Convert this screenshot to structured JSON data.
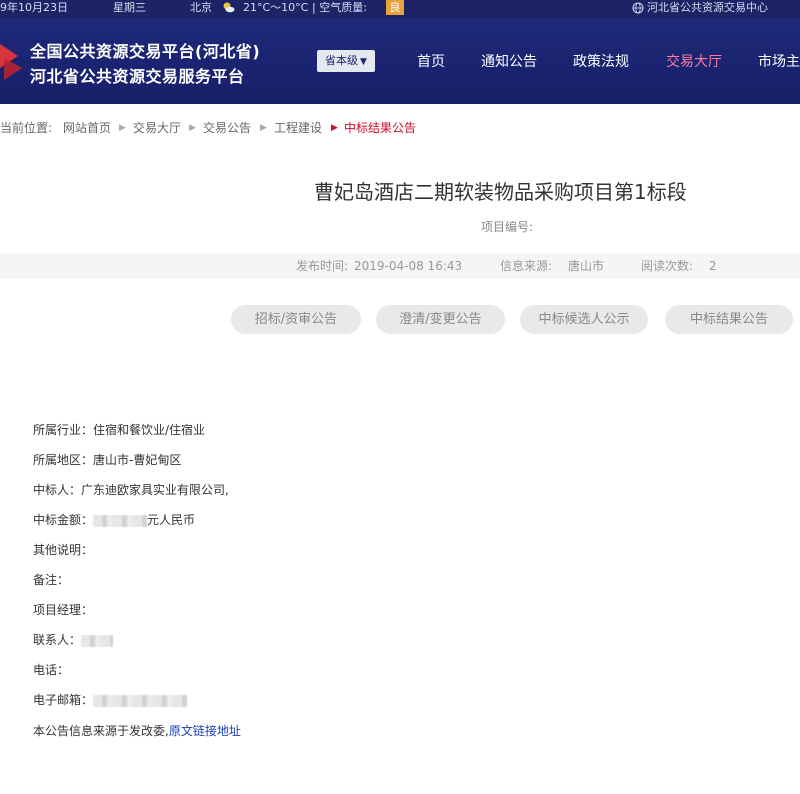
{
  "topbar": {
    "date": "9年10月23日",
    "weekday": "星期三",
    "city": "北京",
    "weather_icon": "sun-cloud-icon",
    "temperature": "21°C～10°C",
    "air_quality_label": "| 空气质量:",
    "air_quality_value": "良",
    "center_link": "河北省公共资源交易中心"
  },
  "header": {
    "title_line1": "全国公共资源交易平台(河北省)",
    "title_line2": "河北省公共资源交易服务平台",
    "level_select": "省本级",
    "nav": [
      "首页",
      "通知公告",
      "政策法规",
      "交易大厅",
      "市场主"
    ],
    "active_nav": "交易大厅"
  },
  "breadcrumb": {
    "label": "当前位置:",
    "items": [
      "网站首页",
      "交易大厅",
      "交易公告",
      "工程建设"
    ],
    "current": "中标结果公告"
  },
  "article": {
    "title": "曹妃岛酒店二期软装物品采购项目第1标段",
    "project_no_label": "项目编号:",
    "publish_time_label": "发布时间:",
    "publish_time": "2019-04-08 16:43",
    "source_label": "信息来源:",
    "source": "唐山市",
    "views_label": "阅读次数:",
    "views": "2"
  },
  "tabs": [
    "招标/资审公告",
    "澄清/变更公告",
    "中标候选人公示",
    "中标结果公告"
  ],
  "content": {
    "industry": "所属行业：住宿和餐饮业/住宿业",
    "region": "所属地区：唐山市-曹妃甸区",
    "winner": "中标人：广东迪欧家具实业有限公司,",
    "amount_label": "中标金额：",
    "amount_unit": "元人民币",
    "other": "其他说明：",
    "remark": "备注：",
    "manager": "项目经理：",
    "contact": "联系人：",
    "phone": "电话：",
    "email": "电子邮箱：",
    "source_note": "本公告信息来源于发改委,",
    "source_link": "原文链接地址"
  }
}
